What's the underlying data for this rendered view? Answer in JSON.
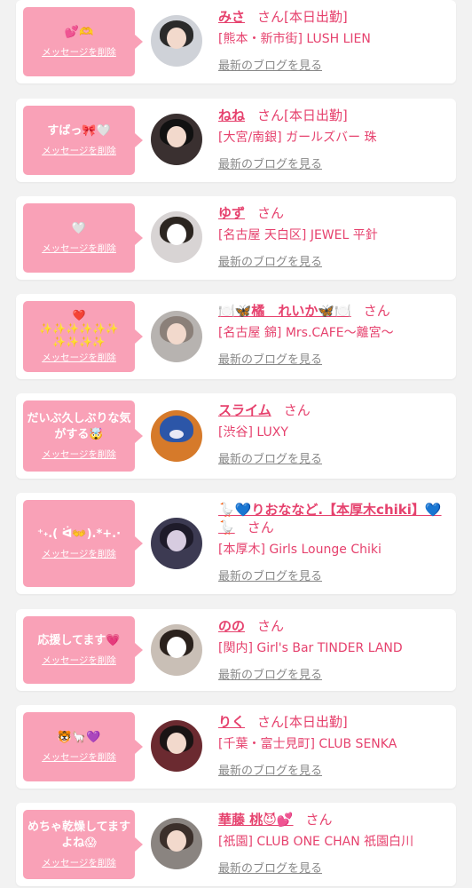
{
  "delete_label": "メッセージを削除",
  "blog_label": "最新のブログを見る",
  "honorific": "さん",
  "items": [
    {
      "message": "💕🫶",
      "name": "みさ",
      "status": "[本日出勤]",
      "shop": "[熊本・新市街] LUSH LIEN"
    },
    {
      "message": "すばっ🎀🤍",
      "name": "ねね",
      "status": "[本日出勤]",
      "shop": "[大宮/南銀] ガールズバー 珠"
    },
    {
      "message": "🤍",
      "name": "ゆず",
      "status": "",
      "shop": "[名古屋 天白区] JEWEL 平針"
    },
    {
      "message": "❤️\n✨✨✨✨✨✨\n✨✨✨✨",
      "name": "🍽️🦋橘　れいか🦋🍽️",
      "status": "",
      "shop": "[名古屋 錦] Mrs.CAFE〜離宮〜"
    },
    {
      "message": "だいぶ久しぶりな気がする🤯",
      "name": "スライム",
      "status": "",
      "shop": "[渋谷] LUXY"
    },
    {
      "message": "⁺˖.( ᐛ👐).*+.·",
      "name": "🪿💙りおななど.【本厚木chiki】💙🪿",
      "status": "",
      "shop": "[本厚木] Girls Lounge Chiki"
    },
    {
      "message": "応援してます💗",
      "name": "のの",
      "status": "",
      "shop": "[関内] Girl's Bar TINDER LAND"
    },
    {
      "message": "🐯🦙💜",
      "name": "りく",
      "status": "[本日出勤]",
      "shop": "[千葉・富士見町] CLUB SENKA"
    },
    {
      "message": "めちゃ乾燥してますよね😱",
      "name": "華藤 桃😈💕",
      "status": "",
      "shop": "[祇園] CLUB ONE CHAN 祇園白川"
    }
  ],
  "colors": {
    "accent": "#e6426e",
    "bubble": "#f9a1b7"
  }
}
